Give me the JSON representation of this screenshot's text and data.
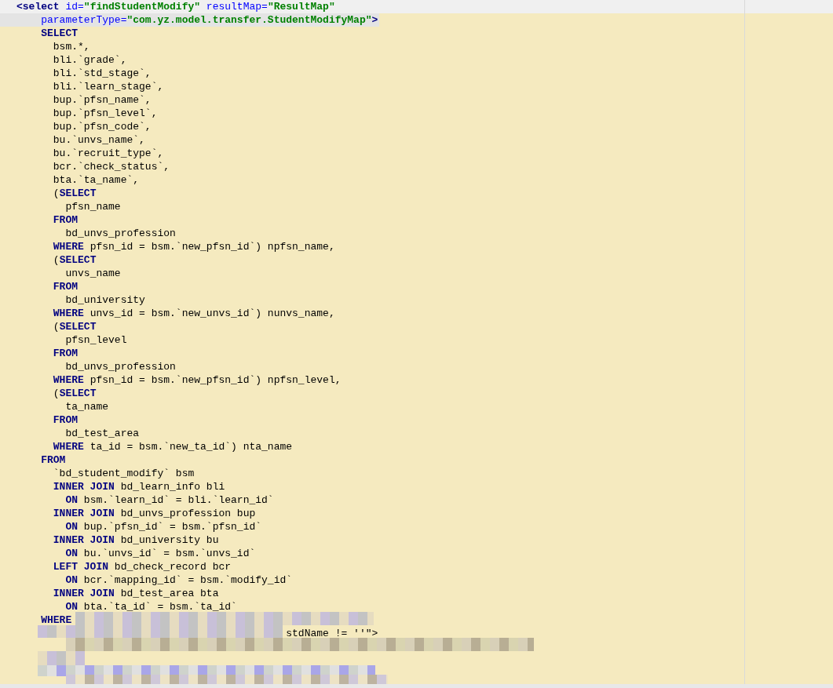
{
  "lines": [
    {
      "current": true,
      "selected": false,
      "tokens": [
        {
          "kind": "tag",
          "text": "<select "
        },
        {
          "kind": "attr",
          "text": "id="
        },
        {
          "kind": "string",
          "text": "\"findStudentModify\" "
        },
        {
          "kind": "attr",
          "text": "resultMap="
        },
        {
          "kind": "string",
          "text": "\"ResultMap\""
        }
      ]
    },
    {
      "current": false,
      "selected": true,
      "tokens": [
        {
          "kind": "attr",
          "text": "    parameterType="
        },
        {
          "kind": "string",
          "text": "\"com.yz.model.transfer.StudentModifyMap\""
        },
        {
          "kind": "tag",
          "text": ">"
        }
      ]
    },
    {
      "current": false,
      "selected": false,
      "tokens": [
        {
          "kind": "keyword",
          "text": "    SELECT"
        }
      ]
    },
    {
      "current": false,
      "selected": false,
      "tokens": [
        {
          "kind": "plain",
          "text": "      bsm.*,"
        }
      ]
    },
    {
      "current": false,
      "selected": false,
      "tokens": [
        {
          "kind": "plain",
          "text": "      bli.`grade`,"
        }
      ]
    },
    {
      "current": false,
      "selected": false,
      "tokens": [
        {
          "kind": "plain",
          "text": "      bli.`std_stage`,"
        }
      ]
    },
    {
      "current": false,
      "selected": false,
      "tokens": [
        {
          "kind": "plain",
          "text": "      bli.`learn_stage`,"
        }
      ]
    },
    {
      "current": false,
      "selected": false,
      "tokens": [
        {
          "kind": "plain",
          "text": "      bup.`pfsn_name`,"
        }
      ]
    },
    {
      "current": false,
      "selected": false,
      "tokens": [
        {
          "kind": "plain",
          "text": "      bup.`pfsn_level`,"
        }
      ]
    },
    {
      "current": false,
      "selected": false,
      "tokens": [
        {
          "kind": "plain",
          "text": "      bup.`pfsn_code`,"
        }
      ]
    },
    {
      "current": false,
      "selected": false,
      "tokens": [
        {
          "kind": "plain",
          "text": "      bu.`unvs_name`,"
        }
      ]
    },
    {
      "current": false,
      "selected": false,
      "tokens": [
        {
          "kind": "plain",
          "text": "      bu.`recruit_type`,"
        }
      ]
    },
    {
      "current": false,
      "selected": false,
      "tokens": [
        {
          "kind": "plain",
          "text": "      bcr.`check_status`,"
        }
      ]
    },
    {
      "current": false,
      "selected": false,
      "tokens": [
        {
          "kind": "plain",
          "text": "      bta.`ta_name`,"
        }
      ]
    },
    {
      "current": false,
      "selected": false,
      "tokens": [
        {
          "kind": "plain",
          "text": "      ("
        },
        {
          "kind": "keyword",
          "text": "SELECT"
        }
      ]
    },
    {
      "current": false,
      "selected": false,
      "tokens": [
        {
          "kind": "plain",
          "text": "        pfsn_name"
        }
      ]
    },
    {
      "current": false,
      "selected": false,
      "tokens": [
        {
          "kind": "keyword",
          "text": "      FROM"
        }
      ]
    },
    {
      "current": false,
      "selected": false,
      "tokens": [
        {
          "kind": "plain",
          "text": "        bd_unvs_profession"
        }
      ]
    },
    {
      "current": false,
      "selected": false,
      "tokens": [
        {
          "kind": "keyword",
          "text": "      WHERE"
        },
        {
          "kind": "plain",
          "text": " pfsn_id = bsm.`new_pfsn_id`) npfsn_name,"
        }
      ]
    },
    {
      "current": false,
      "selected": false,
      "tokens": [
        {
          "kind": "plain",
          "text": "      ("
        },
        {
          "kind": "keyword",
          "text": "SELECT"
        }
      ]
    },
    {
      "current": false,
      "selected": false,
      "tokens": [
        {
          "kind": "plain",
          "text": "        unvs_name"
        }
      ]
    },
    {
      "current": false,
      "selected": false,
      "tokens": [
        {
          "kind": "keyword",
          "text": "      FROM"
        }
      ]
    },
    {
      "current": false,
      "selected": false,
      "tokens": [
        {
          "kind": "plain",
          "text": "        bd_university"
        }
      ]
    },
    {
      "current": false,
      "selected": false,
      "tokens": [
        {
          "kind": "keyword",
          "text": "      WHERE"
        },
        {
          "kind": "plain",
          "text": " unvs_id = bsm.`new_unvs_id`) nunvs_name,"
        }
      ]
    },
    {
      "current": false,
      "selected": false,
      "tokens": [
        {
          "kind": "plain",
          "text": "      ("
        },
        {
          "kind": "keyword",
          "text": "SELECT"
        }
      ]
    },
    {
      "current": false,
      "selected": false,
      "tokens": [
        {
          "kind": "plain",
          "text": "        pfsn_level"
        }
      ]
    },
    {
      "current": false,
      "selected": false,
      "tokens": [
        {
          "kind": "keyword",
          "text": "      FROM"
        }
      ]
    },
    {
      "current": false,
      "selected": false,
      "tokens": [
        {
          "kind": "plain",
          "text": "        bd_unvs_profession"
        }
      ]
    },
    {
      "current": false,
      "selected": false,
      "tokens": [
        {
          "kind": "keyword",
          "text": "      WHERE"
        },
        {
          "kind": "plain",
          "text": " pfsn_id = bsm.`new_pfsn_id`) npfsn_level,"
        }
      ]
    },
    {
      "current": false,
      "selected": false,
      "tokens": [
        {
          "kind": "plain",
          "text": "      ("
        },
        {
          "kind": "keyword",
          "text": "SELECT"
        }
      ]
    },
    {
      "current": false,
      "selected": false,
      "tokens": [
        {
          "kind": "plain",
          "text": "        ta_name"
        }
      ]
    },
    {
      "current": false,
      "selected": false,
      "tokens": [
        {
          "kind": "keyword",
          "text": "      FROM"
        }
      ]
    },
    {
      "current": false,
      "selected": false,
      "tokens": [
        {
          "kind": "plain",
          "text": "        bd_test_area"
        }
      ]
    },
    {
      "current": false,
      "selected": false,
      "tokens": [
        {
          "kind": "keyword",
          "text": "      WHERE"
        },
        {
          "kind": "plain",
          "text": " ta_id = bsm.`new_ta_id`) nta_name"
        }
      ]
    },
    {
      "current": false,
      "selected": false,
      "tokens": [
        {
          "kind": "keyword",
          "text": "    FROM"
        }
      ]
    },
    {
      "current": false,
      "selected": false,
      "tokens": [
        {
          "kind": "plain",
          "text": "      `bd_student_modify` bsm"
        }
      ]
    },
    {
      "current": false,
      "selected": false,
      "tokens": [
        {
          "kind": "keyword",
          "text": "      INNER JOIN"
        },
        {
          "kind": "plain",
          "text": " bd_learn_info bli"
        }
      ]
    },
    {
      "current": false,
      "selected": false,
      "tokens": [
        {
          "kind": "keyword",
          "text": "        ON"
        },
        {
          "kind": "plain",
          "text": " bsm.`learn_id` = bli.`learn_id`"
        }
      ]
    },
    {
      "current": false,
      "selected": false,
      "tokens": [
        {
          "kind": "keyword",
          "text": "      INNER JOIN"
        },
        {
          "kind": "plain",
          "text": " bd_unvs_profession bup"
        }
      ]
    },
    {
      "current": false,
      "selected": false,
      "tokens": [
        {
          "kind": "keyword",
          "text": "        ON"
        },
        {
          "kind": "plain",
          "text": " bup.`pfsn_id` = bsm.`pfsn_id`"
        }
      ]
    },
    {
      "current": false,
      "selected": false,
      "tokens": [
        {
          "kind": "keyword",
          "text": "      INNER JOIN"
        },
        {
          "kind": "plain",
          "text": " bd_university bu"
        }
      ]
    },
    {
      "current": false,
      "selected": false,
      "tokens": [
        {
          "kind": "keyword",
          "text": "        ON"
        },
        {
          "kind": "plain",
          "text": " bu.`unvs_id` = bsm.`unvs_id`"
        }
      ]
    },
    {
      "current": false,
      "selected": false,
      "tokens": [
        {
          "kind": "keyword",
          "text": "      LEFT JOIN"
        },
        {
          "kind": "plain",
          "text": " bd_check_record bcr"
        }
      ]
    },
    {
      "current": false,
      "selected": false,
      "tokens": [
        {
          "kind": "keyword",
          "text": "        ON"
        },
        {
          "kind": "plain",
          "text": " bcr.`mapping_id` = bsm.`modify_id`"
        }
      ]
    },
    {
      "current": false,
      "selected": false,
      "tokens": [
        {
          "kind": "keyword",
          "text": "      INNER JOIN"
        },
        {
          "kind": "plain",
          "text": " bd_test_area bta"
        }
      ]
    },
    {
      "current": false,
      "selected": false,
      "tokens": [
        {
          "kind": "keyword",
          "text": "        ON"
        },
        {
          "kind": "plain",
          "text": " bta.`ta_id` = bsm.`ta_id`"
        }
      ]
    },
    {
      "current": false,
      "selected": false,
      "tokens": [
        {
          "kind": "keyword",
          "text": "    WHERE"
        }
      ]
    },
    {
      "current": false,
      "selected": false,
      "tokens": [
        {
          "kind": "plain",
          "text": "                                            stdName != ''\">"
        }
      ]
    }
  ]
}
